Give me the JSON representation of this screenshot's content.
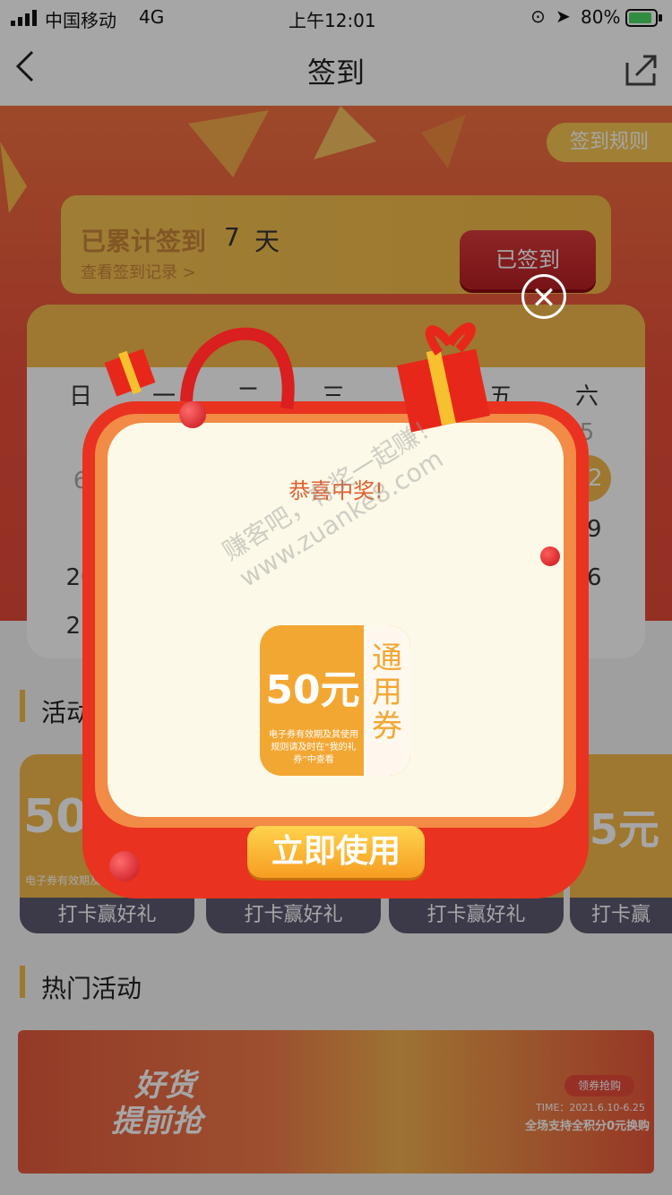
{
  "status_bar": {
    "carrier": "中国移动",
    "network": "4G",
    "time": "上午12:01",
    "battery": "80%"
  },
  "nav": {
    "title": "签到",
    "back_icon": "chevron-left-icon",
    "share_icon": "share-icon"
  },
  "checkin": {
    "rules_label": "签到规则",
    "cumulative_label": "已累计签到",
    "days_count": "7",
    "days_unit": "天",
    "history_link": "查看签到记录 >",
    "signed_button": "已签到"
  },
  "calendar": {
    "weekdays": [
      "日",
      "一",
      "二",
      "三",
      "四",
      "五",
      "六"
    ],
    "visible_dates": {
      "r1c7": "5",
      "r2c1": "6",
      "r2c7": "12",
      "r3c7": "19",
      "r4c1": "20",
      "r4c7": "26",
      "r5c1": "27"
    }
  },
  "activities": {
    "title": "活动",
    "cards": [
      {
        "amount": "50",
        "label": "打卡赢好礼"
      },
      {
        "amount": "",
        "label": "打卡赢好礼"
      },
      {
        "amount": "",
        "label": "打卡赢好礼"
      },
      {
        "amount": "5元",
        "label": "打卡赢"
      }
    ],
    "card_note": "电子券有效期及用规则请及时在"
  },
  "hot": {
    "title": "热门活动",
    "banner": {
      "headline_1": "好货",
      "headline_2": "提前抢",
      "tag": "领券抢购",
      "time": "TIME：2021.6.10-6.25",
      "subtitle": "全场支持全积分0元换购"
    }
  },
  "modal": {
    "title": "恭喜中奖!",
    "coupon_amount": "50元",
    "coupon_type": "通用券",
    "coupon_note": "电子券有效期及其使用规则请及时在“我的礼券”中查看",
    "use_button": "立即使用",
    "close_icon": "close-icon"
  },
  "watermark": "赚客吧，有奖一起赚！ www.zuanke8.com",
  "colors": {
    "accent": "#f3b84a",
    "modal_red": "#e9321f",
    "button_orange": "#f69d21",
    "title_orange": "#e15c2b"
  }
}
